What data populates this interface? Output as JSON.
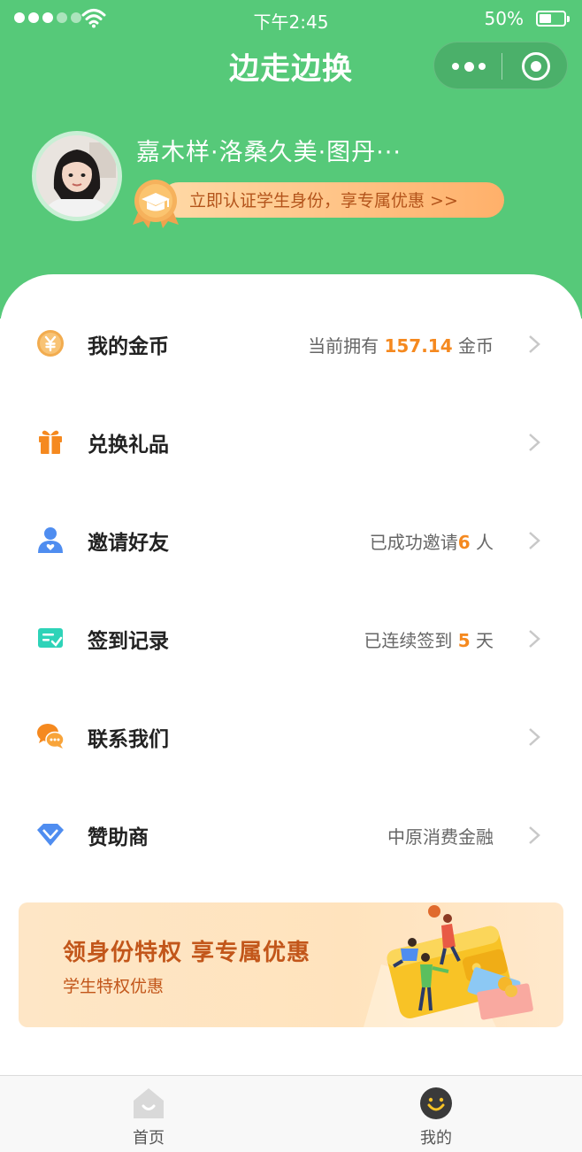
{
  "status_bar": {
    "time": "下午2:45",
    "battery": "50%",
    "battery_level": 0.5
  },
  "nav": {
    "title": "边走边换"
  },
  "profile": {
    "name": "嘉木样·洛桑久美·图丹···",
    "cert_text": "立即认证学生身份，享专属优惠 >>"
  },
  "menu": {
    "coins": {
      "label": "我的金币",
      "value_prefix": "当前拥有 ",
      "value_highlight": "157.14",
      "value_suffix": " 金币",
      "icon": "coin-icon"
    },
    "gifts": {
      "label": "兑换礼品",
      "icon": "gift-icon"
    },
    "invite": {
      "label": "邀请好友",
      "value_prefix": "已成功邀请",
      "value_highlight": "6",
      "value_suffix": " 人",
      "icon": "user-heart-icon"
    },
    "checkin": {
      "label": "签到记录",
      "value_prefix": "已连续签到 ",
      "value_highlight": "5",
      "value_suffix": " 天",
      "icon": "checkin-card-icon"
    },
    "contact": {
      "label": "联系我们",
      "icon": "chat-bubbles-icon"
    },
    "sponsor": {
      "label": "赞助商",
      "value": "中原消费金融",
      "icon": "diamond-icon"
    }
  },
  "banner": {
    "title": "领身份特权 享专属优惠",
    "subtitle": "学生特权优惠"
  },
  "tabbar": {
    "home": "首页",
    "mine": "我的",
    "active": "mine"
  },
  "colors": {
    "primary_green": "#56c979",
    "accent_orange": "#f5891f",
    "banner_text": "#c2561a"
  }
}
